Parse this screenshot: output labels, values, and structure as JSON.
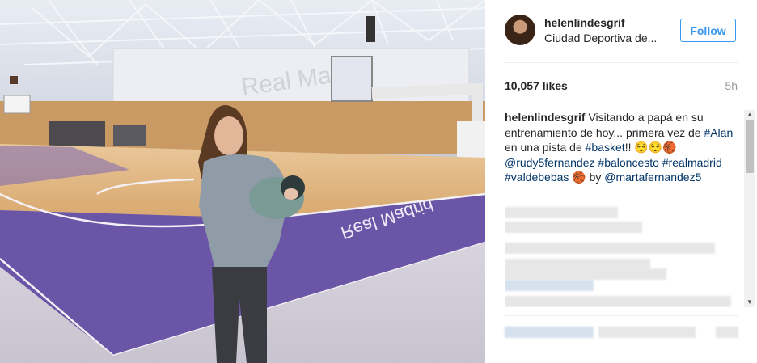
{
  "post": {
    "username": "helenlindesgrif",
    "location": "Ciudad Deportiva de...",
    "follow_label": "Follow",
    "likes": "10,057 likes",
    "time_ago": "5h"
  },
  "caption": {
    "username": "helenlindesgrif",
    "text_1": "Visitando a papá en su entrenamiento de hoy... primera vez de ",
    "tag_alan": "#Alan",
    "text_2": " en una pista de ",
    "tag_basket": "#basket",
    "text_3": "!! 😌😌🏀",
    "tag_rudy": "@rudy5fernandez",
    "tag_baloncesto": "#baloncesto",
    "tag_realmadrid": "#realmadrid",
    "tag_valdebebas": "#valdebebas",
    "text_4": " 🏀 by ",
    "tag_marta": "@martafernandez5"
  },
  "photo": {
    "banner_text": "Real Madrid",
    "court_text": "Real Madrid"
  },
  "icons": {
    "scroll_up": "scroll-up-arrow-icon",
    "scroll_down": "scroll-down-arrow-icon"
  },
  "colors": {
    "link": "#003569",
    "follow": "#3897f0",
    "court_purple": "#6b55a6"
  }
}
